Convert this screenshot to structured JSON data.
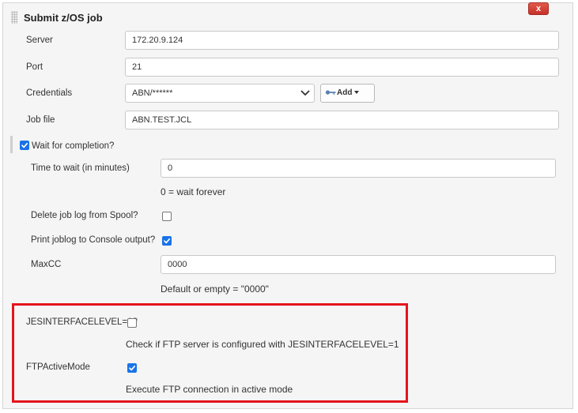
{
  "section": {
    "title": "Submit z/OS job",
    "close_label": "x"
  },
  "fields": {
    "server": {
      "label": "Server",
      "value": "172.20.9.124"
    },
    "port": {
      "label": "Port",
      "value": "21"
    },
    "credentials": {
      "label": "Credentials",
      "selected": "ABN/******",
      "add_label": "Add"
    },
    "job_file": {
      "label": "Job file",
      "value": "ABN.TEST.JCL"
    }
  },
  "wait": {
    "label": "Wait for completion?",
    "checked": true,
    "time_label": "Time to wait (in minutes)",
    "time_value": "0",
    "time_help": "0 = wait forever",
    "delete_log_label": "Delete job log from Spool?",
    "delete_log_checked": false,
    "print_log_label": "Print joblog to Console output?",
    "print_log_checked": true,
    "maxcc_label": "MaxCC",
    "maxcc_value": "0000",
    "maxcc_help": "Default or empty = \"0000\""
  },
  "jes": {
    "label": "JESINTERFACELEVEL=1?",
    "checked": false,
    "help": "Check if FTP server is configured with JESINTERFACELEVEL=1"
  },
  "ftp_active": {
    "label": "FTPActiveMode",
    "checked": true,
    "help": "Execute FTP connection in active mode"
  },
  "colors": {
    "highlight_border": "#e4141c",
    "checkbox_accent": "#1a73e8",
    "close_button": "#d0402f"
  }
}
